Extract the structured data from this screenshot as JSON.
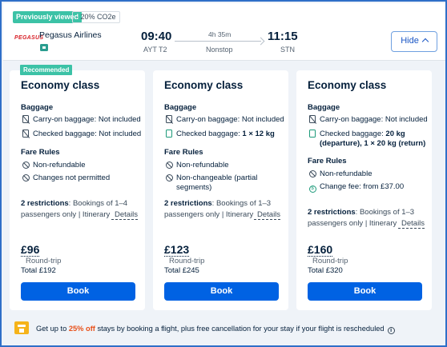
{
  "header": {
    "previously_viewed": "Previously viewed",
    "co2": "20% CO2e",
    "airline_logo_text": "PEGASUS",
    "airline_name": "Pegasus Airlines",
    "departure_time": "09:40",
    "departure_airport": "AYT T2",
    "duration": "4h 35m",
    "stops": "Nonstop",
    "arrival_time": "11:15",
    "arrival_airport": "STN",
    "hide_label": "Hide"
  },
  "recommended_label": "Recommended",
  "cards": [
    {
      "title": "Economy class",
      "baggage_heading": "Baggage",
      "carry_on": "Carry-on baggage: Not included",
      "checked_prefix": "Checked baggage: ",
      "checked_value": "Not included",
      "fare_heading": "Fare Rules",
      "rule1": "Non-refundable",
      "rule2": "Changes not permitted",
      "restrictions_bold": "2 restrictions",
      "restrictions_text": ": Bookings of 1–4 passengers only | Itinerary",
      "details": "Details",
      "price": "£96",
      "round_trip": "Round-trip",
      "total": "Total £192",
      "book": "Book"
    },
    {
      "title": "Economy class",
      "baggage_heading": "Baggage",
      "carry_on": "Carry-on baggage: Not included",
      "checked_prefix": "Checked baggage: ",
      "checked_value": "1 × 12 kg",
      "fare_heading": "Fare Rules",
      "rule1": "Non-refundable",
      "rule2": "Non-changeable (partial segments)",
      "restrictions_bold": "2 restrictions",
      "restrictions_text": ": Bookings of 1–3 passengers only | Itinerary",
      "details": "Details",
      "price": "£123",
      "round_trip": "Round-trip",
      "total": "Total £245",
      "book": "Book"
    },
    {
      "title": "Economy class",
      "baggage_heading": "Baggage",
      "carry_on": "Carry-on baggage: Not included",
      "checked_prefix": "Checked baggage: ",
      "checked_value": "20 kg (departure), 1 × 20 kg (return)",
      "fare_heading": "Fare Rules",
      "rule1": "Non-refundable",
      "rule2": "Change fee: from £37.00",
      "restrictions_bold": "2 restrictions",
      "restrictions_text": ": Bookings of 1–3 passengers only | Itinerary",
      "details": "Details",
      "price": "£160",
      "round_trip": "Round-trip",
      "total": "Total £320",
      "book": "Book"
    }
  ],
  "footer": {
    "text_before": "Get up to ",
    "highlight": "25% off",
    "text_after": " stays by booking a flight, plus free cancellation for your stay if your flight is rescheduled"
  }
}
